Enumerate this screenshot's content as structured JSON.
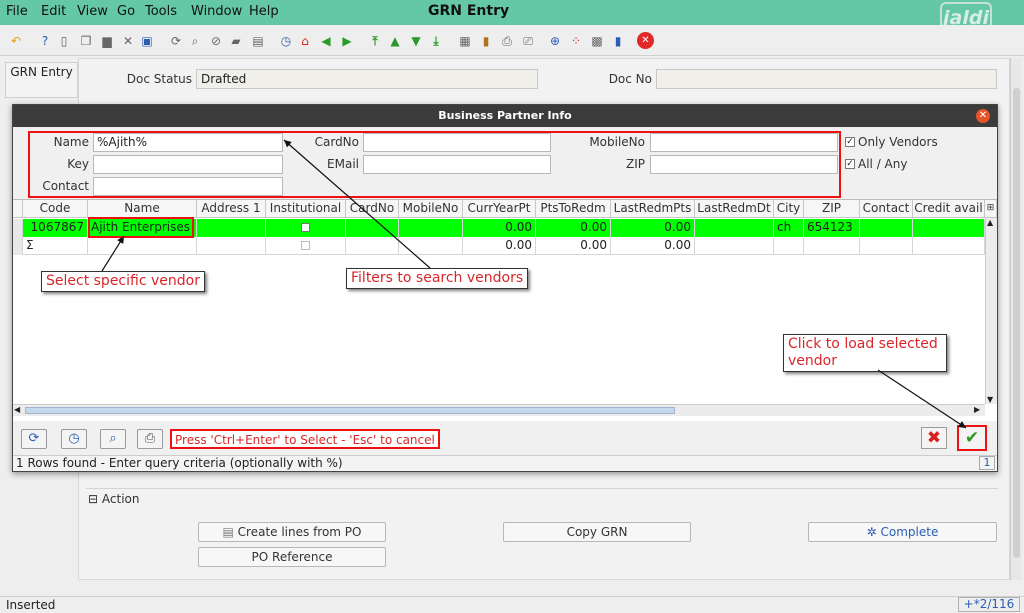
{
  "menu": {
    "items": [
      "File",
      "Edit",
      "View",
      "Go",
      "Tools",
      "Window",
      "Help"
    ],
    "title": "GRN Entry",
    "logo_text": "jaldi"
  },
  "toolbar": {
    "icons": [
      "undo-icon",
      "help-icon",
      "new-icon",
      "copy-icon",
      "delete-icon",
      "delete-selection-icon",
      "save-icon",
      "refresh-icon",
      "find-icon",
      "attachment-icon",
      "chat-icon",
      "grid-toggle-icon",
      "history-icon",
      "home-icon",
      "previous-icon",
      "next-icon",
      "first-record-icon",
      "previous-record-icon",
      "next-record-icon",
      "last-record-icon",
      "report-icon",
      "archive-icon",
      "print-icon",
      "print-preview-icon",
      "zoom-across-icon",
      "workflow-icon",
      "product-info-icon",
      "end-icon",
      "close-window-icon"
    ]
  },
  "left_tab": {
    "label": "GRN Entry"
  },
  "form": {
    "doc_status_label": "Doc Status",
    "doc_status_value": "Drafted",
    "doc_no_label": "Doc No"
  },
  "action": {
    "header": "Action",
    "create_lines_label": "Create lines from PO",
    "copy_grn_label": "Copy GRN",
    "complete_label": "Complete",
    "po_reference_label": "PO Reference"
  },
  "status": {
    "text": "Inserted",
    "count": "+*2/116"
  },
  "dialog": {
    "title": "Business Partner Info",
    "fields": {
      "name_label": "Name",
      "name_value": "%Ajith%",
      "key_label": "Key",
      "contact_label": "Contact",
      "cardno_label": "CardNo",
      "email_label": "EMail",
      "mobileno_label": "MobileNo",
      "zip_label": "ZIP",
      "only_vendors_label": "Only Vendors",
      "all_any_label": "All / Any"
    },
    "columns": [
      "Code",
      "Name",
      "Address 1",
      "Institutional",
      "CardNo",
      "MobileNo",
      "CurrYearPt",
      "PtsToRedm",
      "LastRedmPts",
      "LastRedmDt",
      "City",
      "ZIP",
      "Contact",
      "Credit avail"
    ],
    "rows": [
      {
        "code": "1067867",
        "name": "Ajith Enterprises",
        "address": "",
        "curryearpt": "0.00",
        "ptstoredm": "0.00",
        "lastredmpts": "0.00",
        "city": "ch",
        "zip": "654123"
      }
    ],
    "totals": {
      "symbol": "Σ",
      "curryearpt": "0.00",
      "ptstoredm": "0.00",
      "lastredmpts": "0.00"
    },
    "hint": "Press 'Ctrl+Enter' to Select - 'Esc' to cancel",
    "status": "1 Rows found - Enter query criteria (optionally with %)",
    "page": "1"
  },
  "callouts": {
    "select_vendor": "Select specific vendor",
    "filters": "Filters to search vendors",
    "load_vendor_line1": "Click to load selected",
    "load_vendor_line2": "vendor"
  },
  "colors": {
    "menubar": "#64c8a6",
    "selected_row": "#00ff00",
    "annotation": "#e11111"
  }
}
